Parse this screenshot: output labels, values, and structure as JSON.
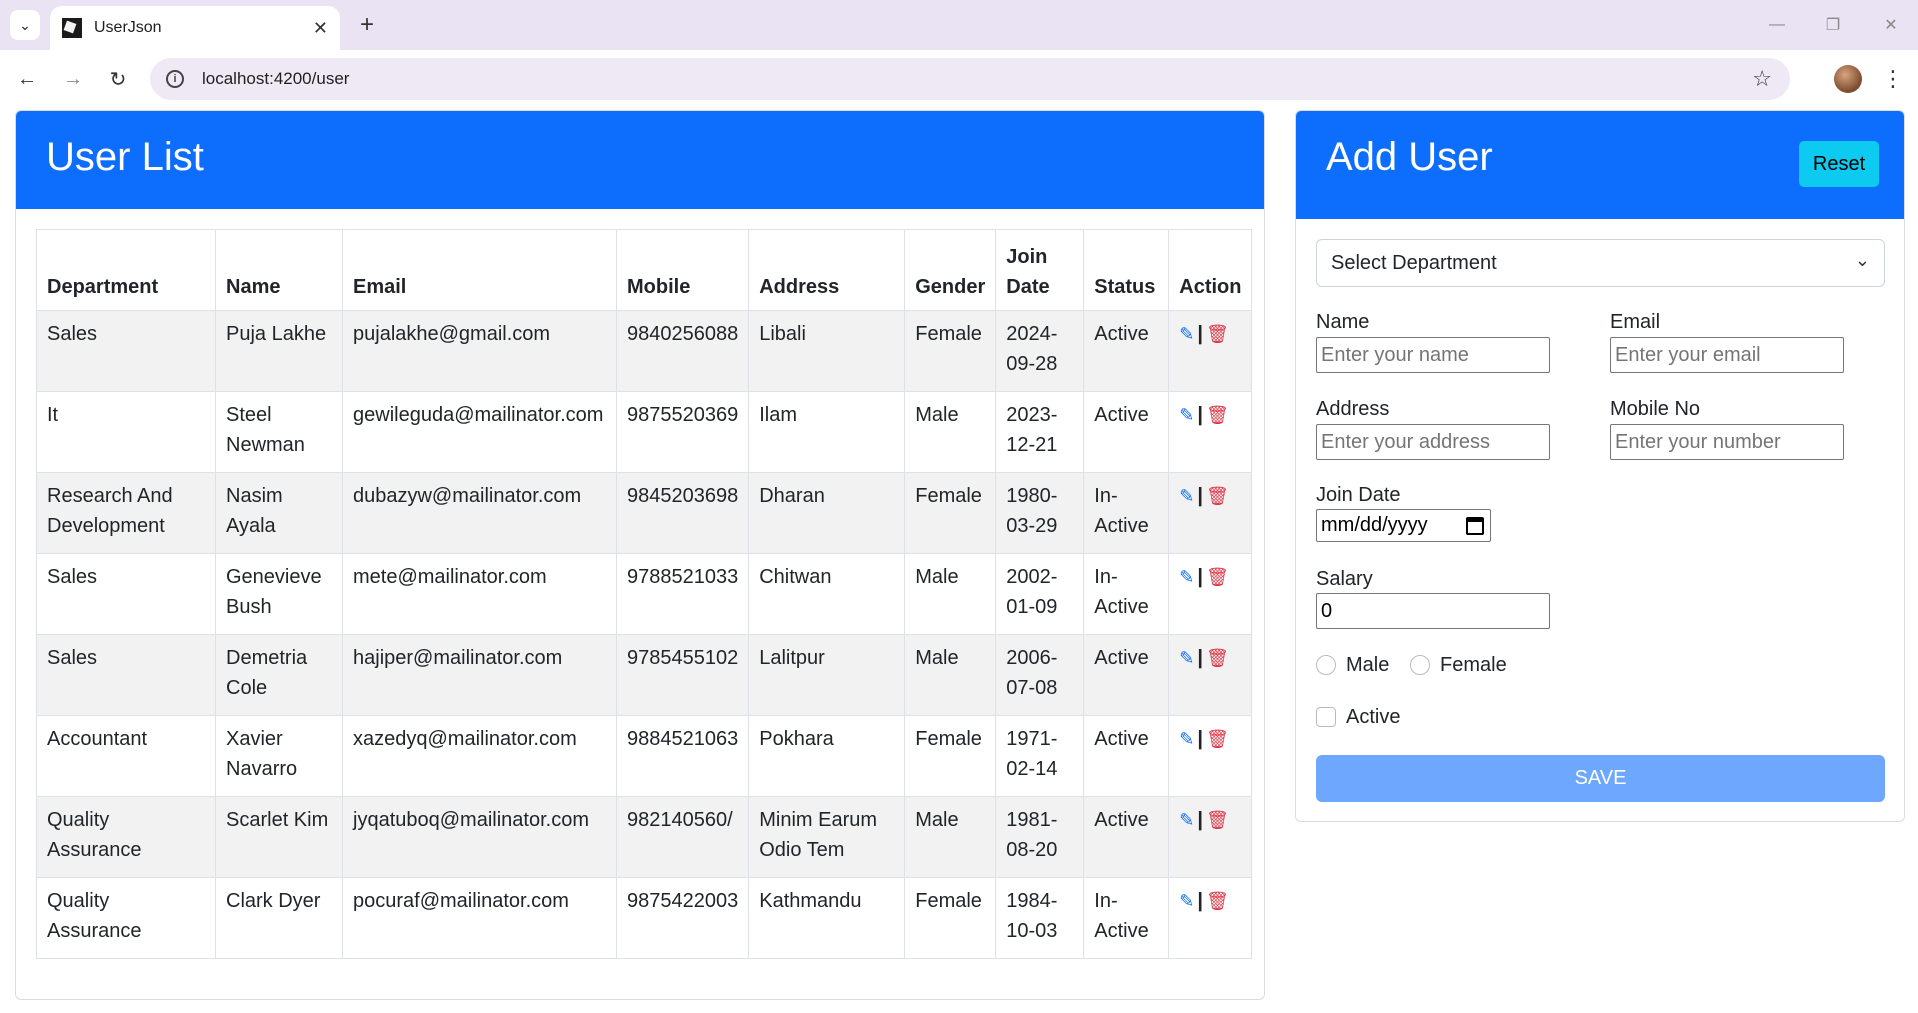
{
  "browser": {
    "tab_title": "UserJson",
    "url": "localhost:4200/user"
  },
  "user_list": {
    "title": "User List",
    "columns": [
      "Department",
      "Name",
      "Email",
      "Mobile",
      "Address",
      "Gender",
      "Join Date",
      "Status",
      "Action"
    ],
    "rows": [
      {
        "department": "Sales",
        "name": "Puja Lakhe",
        "email": "pujalakhe@gmail.com",
        "mobile": "9840256088",
        "address": "Libali",
        "gender": "Female",
        "join_date": "2024-09-28",
        "status": "Active"
      },
      {
        "department": "It",
        "name": "Steel Newman",
        "email": "gewileguda@mailinator.com",
        "mobile": "9875520369",
        "address": "Ilam",
        "gender": "Male",
        "join_date": "2023-12-21",
        "status": "Active"
      },
      {
        "department": "Research And Development",
        "name": "Nasim Ayala",
        "email": "dubazyw@mailinator.com",
        "mobile": "9845203698",
        "address": "Dharan",
        "gender": "Female",
        "join_date": "1980-03-29",
        "status": "In-Active"
      },
      {
        "department": "Sales",
        "name": "Genevieve Bush",
        "email": "mete@mailinator.com",
        "mobile": "9788521033",
        "address": "Chitwan",
        "gender": "Male",
        "join_date": "2002-01-09",
        "status": "In-Active"
      },
      {
        "department": "Sales",
        "name": "Demetria Cole",
        "email": "hajiper@mailinator.com",
        "mobile": "9785455102",
        "address": "Lalitpur",
        "gender": "Male",
        "join_date": "2006-07-08",
        "status": "Active"
      },
      {
        "department": "Accountant",
        "name": "Xavier Navarro",
        "email": "xazedyq@mailinator.com",
        "mobile": "9884521063",
        "address": "Pokhara",
        "gender": "Female",
        "join_date": "1971-02-14",
        "status": "Active"
      },
      {
        "department": "Quality Assurance",
        "name": "Scarlet Kim",
        "email": "jyqatuboq@mailinator.com",
        "mobile": "982140560/",
        "address": "Minim Earum Odio Tem",
        "gender": "Male",
        "join_date": "1981-08-20",
        "status": "Active"
      },
      {
        "department": "Quality Assurance",
        "name": "Clark Dyer",
        "email": "pocuraf@mailinator.com",
        "mobile": "9875422003",
        "address": "Kathmandu",
        "gender": "Female",
        "join_date": "1984-10-03",
        "status": "In-Active"
      }
    ],
    "action_separator": "|"
  },
  "add_user": {
    "title": "Add User",
    "reset_label": "Reset",
    "department_select": "Select Department",
    "name_label": "Name",
    "name_placeholder": "Enter your name",
    "email_label": "Email",
    "email_placeholder": "Enter your email",
    "address_label": "Address",
    "address_placeholder": "Enter your address",
    "mobile_label": "Mobile No",
    "mobile_placeholder": "Enter your  number",
    "join_date_label": "Join Date",
    "join_date_placeholder": "mm/dd/yyyy",
    "salary_label": "Salary",
    "salary_value": "0",
    "gender_male": "Male",
    "gender_female": "Female",
    "active_label": "Active",
    "save_label": "SAVE"
  },
  "colors": {
    "primary": "#0d6efd",
    "reset_button": "#0dcaf0",
    "save_button": "#6ea8fe",
    "delete_icon": "#dc3545"
  }
}
